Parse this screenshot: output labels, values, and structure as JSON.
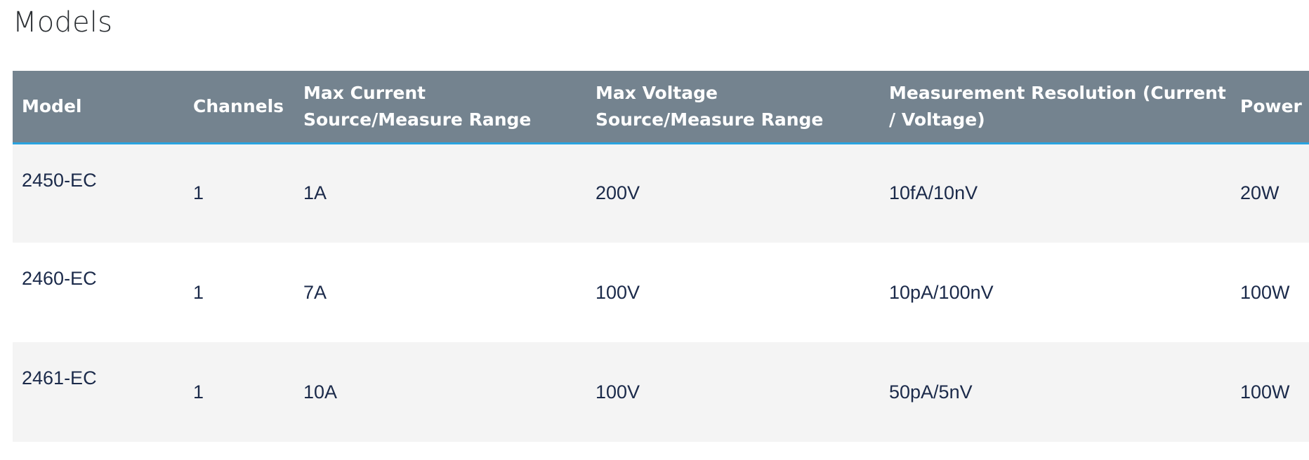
{
  "page": {
    "title": "Models"
  },
  "table": {
    "columns": [
      "Model",
      "Channels",
      "Max Current Source/Measure Range",
      "Max Voltage Source/Measure Range",
      "Measurement Resolution (Current / Voltage)",
      "Power"
    ],
    "rows": [
      {
        "model": "2450-EC",
        "channels": "1",
        "max_current": "1A",
        "max_voltage": "200V",
        "resolution": "10fA/10nV",
        "power": "20W"
      },
      {
        "model": "2460-EC",
        "channels": "1",
        "max_current": "7A",
        "max_voltage": "100V",
        "resolution": "10pA/100nV",
        "power": "100W"
      },
      {
        "model": "2461-EC",
        "channels": "1",
        "max_current": "10A",
        "max_voltage": "100V",
        "resolution": "50pA/5nV",
        "power": "100W"
      }
    ]
  },
  "colors": {
    "header_background": "#74838f",
    "header_accent_border": "#2aa3e0",
    "row_alt_background": "#f4f4f4",
    "cell_text": "#1b2a4a"
  }
}
